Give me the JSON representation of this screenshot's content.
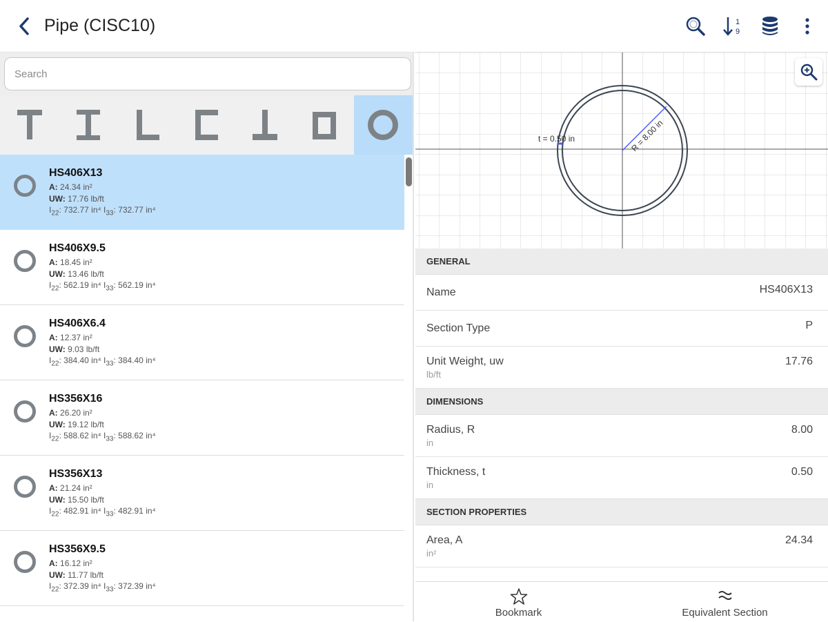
{
  "header": {
    "title": "Pipe (CISC10)"
  },
  "search": {
    "placeholder": "Search",
    "value": ""
  },
  "shape_filters": [
    "T",
    "I",
    "L",
    "C",
    "inverted-T",
    "square-tube",
    "pipe"
  ],
  "list": [
    {
      "name": "HS406X13",
      "a": "24.34 in²",
      "uw": "17.76 lb/ft",
      "i22": "732.77 in⁴",
      "i33": "732.77 in⁴",
      "selected": true
    },
    {
      "name": "HS406X9.5",
      "a": "18.45 in²",
      "uw": "13.46 lb/ft",
      "i22": "562.19 in⁴",
      "i33": "562.19 in⁴"
    },
    {
      "name": "HS406X6.4",
      "a": "12.37 in²",
      "uw": "9.03 lb/ft",
      "i22": "384.40 in⁴",
      "i33": "384.40 in⁴"
    },
    {
      "name": "HS356X16",
      "a": "26.20 in²",
      "uw": "19.12 lb/ft",
      "i22": "588.62 in⁴",
      "i33": "588.62 in⁴"
    },
    {
      "name": "HS356X13",
      "a": "21.24 in²",
      "uw": "15.50 lb/ft",
      "i22": "482.91 in⁴",
      "i33": "482.91 in⁴"
    },
    {
      "name": "HS356X9.5",
      "a": "16.12 in²",
      "uw": "11.77 lb/ft",
      "i22": "372.39 in⁴",
      "i33": "372.39 in⁴"
    }
  ],
  "labels": {
    "a": "A:",
    "uw": "UW:",
    "i22": "I22:",
    "i33": "I33:"
  },
  "diagram": {
    "thickness_label": "t = 0.50 in",
    "radius_label": "R = 8.00 in"
  },
  "properties": {
    "general": {
      "header": "GENERAL",
      "name_label": "Name",
      "name_value": "HS406X13",
      "type_label": "Section Type",
      "type_value": "P",
      "uw_label": "Unit Weight, uw",
      "uw_unit": "lb/ft",
      "uw_value": "17.76"
    },
    "dimensions": {
      "header": "DIMENSIONS",
      "r_label": "Radius, R",
      "r_unit": "in",
      "r_value": "8.00",
      "t_label": "Thickness, t",
      "t_unit": "in",
      "t_value": "0.50"
    },
    "section": {
      "header": "SECTION PROPERTIES",
      "a_label": "Area, A",
      "a_unit": "in²",
      "a_value": "24.34"
    }
  },
  "bottom": {
    "bookmark": "Bookmark",
    "equivalent": "Equivalent Section"
  },
  "colors": {
    "selected": "#bfe0fb",
    "accent": "#1d3a6e",
    "radius_line": "#4a5cff"
  }
}
